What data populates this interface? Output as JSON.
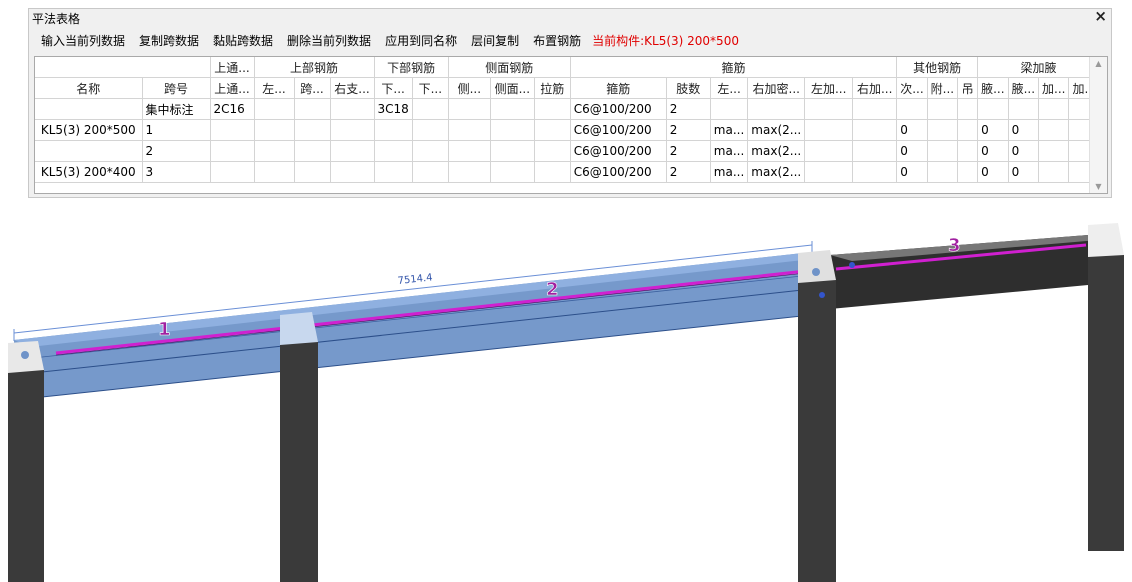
{
  "panel": {
    "title": "平法表格",
    "close_glyph": "×"
  },
  "toolbar": {
    "buttons": [
      "输入当前列数据",
      "复制跨数据",
      "黏贴跨数据",
      "删除当前列数据",
      "应用到同名称",
      "层间复制",
      "布置钢筋"
    ],
    "status": "当前构件:KL5(3) 200*500"
  },
  "table": {
    "group_headers": [
      "上通...",
      "上部钢筋",
      "下部钢筋",
      "侧面钢筋",
      "箍筋",
      "其他钢筋",
      "梁加腋"
    ],
    "columns": [
      "名称",
      "跨号",
      "上通...",
      "左...",
      "跨...",
      "右支...",
      "下...",
      "下...",
      "侧...",
      "侧面...",
      "拉筋",
      "箍筋",
      "肢数",
      "左...",
      "右加密...",
      "左加...",
      "右加...",
      "次...",
      "附...",
      "吊",
      "腋...",
      "腋...",
      "加...",
      "加..."
    ],
    "rows": [
      [
        "",
        "集中标注",
        "2C16",
        "",
        "",
        "",
        "3C18",
        "",
        "",
        "",
        "",
        "C6@100/200",
        "2",
        "",
        "",
        "",
        "",
        "",
        "",
        "",
        "",
        "",
        "",
        ""
      ],
      [
        "KL5(3) 200*500",
        "1",
        "",
        "",
        "",
        "",
        "",
        "",
        "",
        "",
        "",
        "C6@100/200",
        "2",
        "ma...",
        "max(2...",
        "",
        "",
        "0",
        "",
        "",
        "0",
        "0",
        "",
        ""
      ],
      [
        "",
        "2",
        "",
        "",
        "",
        "",
        "",
        "",
        "",
        "",
        "",
        "C6@100/200",
        "2",
        "ma...",
        "max(2...",
        "",
        "",
        "0",
        "",
        "",
        "0",
        "0",
        "",
        ""
      ],
      [
        "KL5(3) 200*400",
        "3",
        "",
        "",
        "",
        "",
        "",
        "",
        "",
        "",
        "",
        "C6@100/200",
        "2",
        "ma...",
        "max(2...",
        "",
        "",
        "0",
        "",
        "",
        "0",
        "0",
        "",
        ""
      ]
    ]
  },
  "scene": {
    "dimension_label": "7514.4",
    "span_labels": [
      "1",
      "2",
      "3"
    ],
    "colors": {
      "beam_selected": "#6f93c8",
      "beam_selected_dark": "#4a6fa5",
      "beam_dark": "#2e2e2e",
      "rebar": "#d020d0",
      "column": "#3a3a3a",
      "column_cap": "#e8e8e8",
      "dimension": "#6a8fd6",
      "label": "#a020a0"
    }
  }
}
